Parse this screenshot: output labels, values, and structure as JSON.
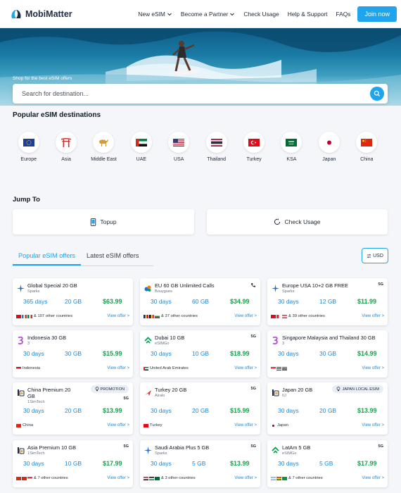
{
  "header": {
    "logo_text": "MobiMatter",
    "nav": [
      {
        "label": "New eSIM",
        "dropdown": true
      },
      {
        "label": "Become a Partner",
        "dropdown": true
      },
      {
        "label": "Check Usage",
        "dropdown": false
      },
      {
        "label": "Help & Support",
        "dropdown": false
      },
      {
        "label": "FAQs",
        "dropdown": false
      }
    ],
    "join_label": "Join now"
  },
  "hero": {
    "tagline": "Shop for the best eSIM offers",
    "search_placeholder": "Search for destination..."
  },
  "destinations": {
    "title": "Popular eSIM destinations",
    "items": [
      {
        "label": "Europe",
        "icon": "eu-flag-icon"
      },
      {
        "label": "Asia",
        "icon": "torii-gate-icon"
      },
      {
        "label": "Middle East",
        "icon": "camel-icon"
      },
      {
        "label": "UAE",
        "icon": "uae-flag-icon"
      },
      {
        "label": "USA",
        "icon": "usa-flag-icon"
      },
      {
        "label": "Thailand",
        "icon": "thailand-flag-icon"
      },
      {
        "label": "Turkey",
        "icon": "turkey-flag-icon"
      },
      {
        "label": "KSA",
        "icon": "saudi-flag-icon"
      },
      {
        "label": "Japan",
        "icon": "japan-flag-icon"
      },
      {
        "label": "China",
        "icon": "china-flag-icon"
      }
    ]
  },
  "jump": {
    "title": "Jump To",
    "topup_label": "Topup",
    "usage_label": "Check Usage"
  },
  "tabs": {
    "popular": "Popular eSIM offers",
    "latest": "Latest eSIM offers",
    "currency": "USD"
  },
  "colors": {
    "accent": "#1ea5ee",
    "price_green": "#16a34a",
    "link_blue": "#1e88d6"
  },
  "offers": [
    {
      "title": "Global Special 20 GB",
      "provider": "Sparks",
      "days": "365 days",
      "data": "20 GB",
      "price": "$63.99",
      "countries": "& 107 other countries",
      "view": "View offer >",
      "logo": "sparks-logo-icon",
      "badge": ""
    },
    {
      "title": "EU 60 GB Unlimited Calls",
      "provider": "Bouygues",
      "days": "30 days",
      "data": "60 GB",
      "price": "$34.99",
      "countries": "& 37 other countries",
      "view": "View offer >",
      "logo": "bouygues-logo-icon",
      "badge": "phone"
    },
    {
      "title": "Europe USA 10+2 GB FREE",
      "provider": "Sparks",
      "days": "30 days",
      "data": "12 GB",
      "price": "$11.99",
      "countries": "& 39 other countries",
      "view": "View offer >",
      "logo": "sparks-logo-icon",
      "badge": "5G"
    },
    {
      "title": "Indonesia 30 GB",
      "provider": "3",
      "days": "30 days",
      "data": "30 GB",
      "price": "$15.99",
      "countries": "Indonesia",
      "view": "View offer >",
      "logo": "three-logo-icon",
      "badge": ""
    },
    {
      "title": "Dubai 10 GB",
      "provider": "eSIMGo",
      "days": "30 days",
      "data": "10 GB",
      "price": "$18.99",
      "countries": "United Arab Emirates",
      "view": "View offer >",
      "logo": "esimgo-logo-icon",
      "badge": "5G"
    },
    {
      "title": "Singapore Malaysia and Thailand 30 GB",
      "provider": "3",
      "days": "30 days",
      "data": "30 GB",
      "price": "$14.99",
      "countries": "",
      "view": "View offer >",
      "logo": "three-logo-icon",
      "badge": ""
    },
    {
      "title": "China Premium 20 GB",
      "provider": "1SimTech",
      "days": "30 days",
      "data": "20 GB",
      "price": "$13.99",
      "countries": "China",
      "view": "View offer >",
      "logo": "simtech-logo-icon",
      "badge": "5G",
      "pill": "PROMOTION"
    },
    {
      "title": "Turkey 20 GB",
      "provider": "Airalo",
      "days": "30 days",
      "data": "20 GB",
      "price": "$15.99",
      "countries": "Turkey",
      "view": "View offer >",
      "logo": "airalo-logo-icon",
      "badge": "5G"
    },
    {
      "title": "Japan 20 GB",
      "provider": "IIJ",
      "days": "30 days",
      "data": "20 GB",
      "price": "$13.99",
      "countries": "Japan",
      "view": "View offer >",
      "logo": "simtech-logo-icon",
      "badge": "",
      "pill": "JAPAN LOCAL ESIM"
    },
    {
      "title": "Asia Premium 10 GB",
      "provider": "1SimTech",
      "days": "30 days",
      "data": "10 GB",
      "price": "$17.99",
      "countries": "& 7 other countries",
      "view": "View offer >",
      "logo": "simtech-logo-icon",
      "badge": "5G"
    },
    {
      "title": "Saudi Arabia Plus 5 GB",
      "provider": "Sparks",
      "days": "30 days",
      "data": "5 GB",
      "price": "$13.99",
      "countries": "& 3 other countries",
      "view": "View offer >",
      "logo": "sparks-logo-icon",
      "badge": "5G"
    },
    {
      "title": "LatAm 5 GB",
      "provider": "eSIMGo",
      "days": "30 days",
      "data": "5 GB",
      "price": "$17.99",
      "countries": "& 7 other countries",
      "view": "View offer >",
      "logo": "esimgo-logo-icon",
      "badge": "5G"
    }
  ]
}
